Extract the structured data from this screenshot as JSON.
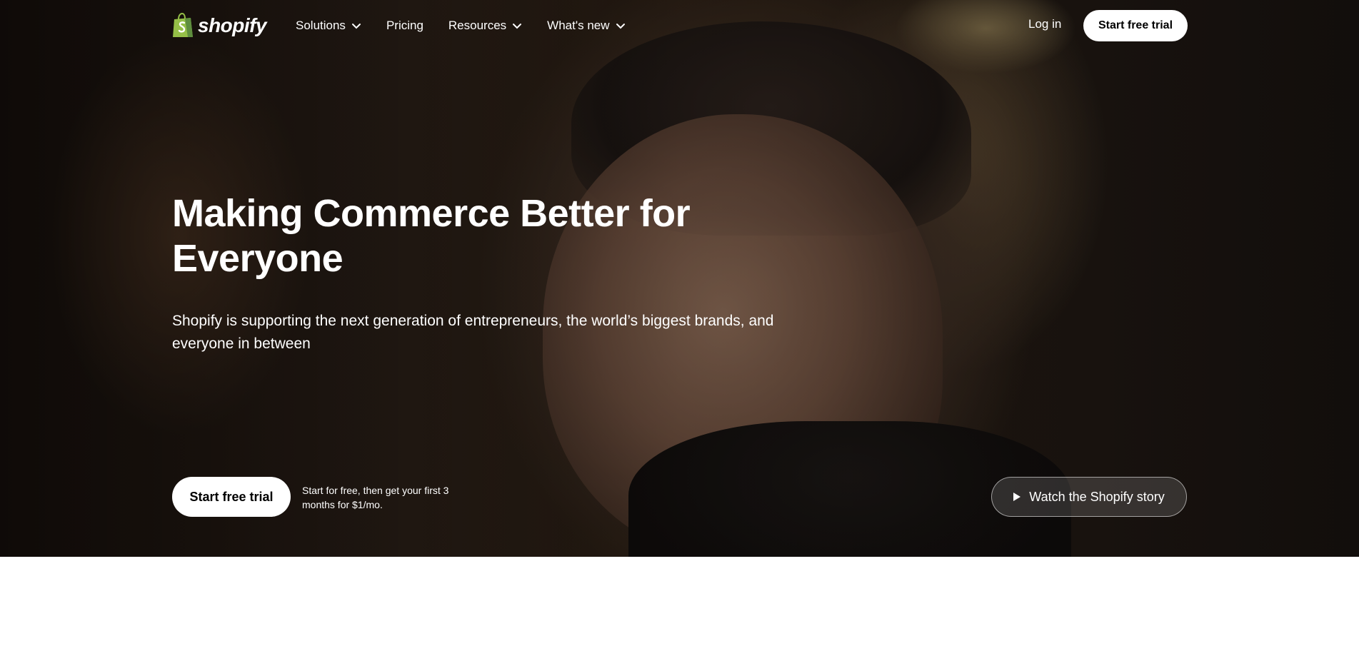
{
  "brand": {
    "name": "shopify",
    "color": "#95bf47"
  },
  "nav": {
    "items": [
      {
        "label": "Solutions",
        "has_dropdown": true
      },
      {
        "label": "Pricing",
        "has_dropdown": false
      },
      {
        "label": "Resources",
        "has_dropdown": true
      },
      {
        "label": "What's new",
        "has_dropdown": true
      }
    ],
    "login_label": "Log in",
    "cta_label": "Start free trial"
  },
  "hero": {
    "headline": "Making Commerce Better for Everyone",
    "subtext": "Shopify is supporting the next generation of entrepreneurs, the world’s biggest brands, and everyone in between",
    "cta_label": "Start free trial",
    "cta_note": "Start for free, then get your first 3 months for $1/mo.",
    "watch_label": "Watch the Shopify story"
  },
  "icons": [
    "shopify-bag-icon",
    "chevron-down-icon",
    "play-icon"
  ]
}
